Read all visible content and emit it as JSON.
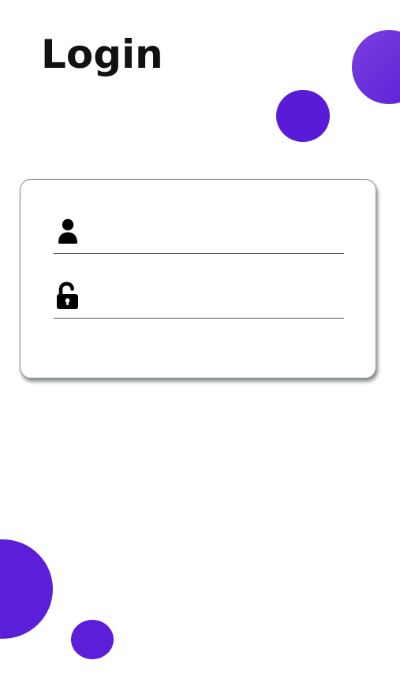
{
  "page": {
    "title": "Login"
  },
  "form": {
    "username": {
      "value": "",
      "placeholder": "",
      "icon": "user-icon"
    },
    "password": {
      "value": "",
      "placeholder": "",
      "icon": "unlock-icon"
    }
  },
  "colors": {
    "accent": "#5b1fd9",
    "accent_light": "#7a3fe0",
    "text": "#111111",
    "background": "#ffffff"
  }
}
